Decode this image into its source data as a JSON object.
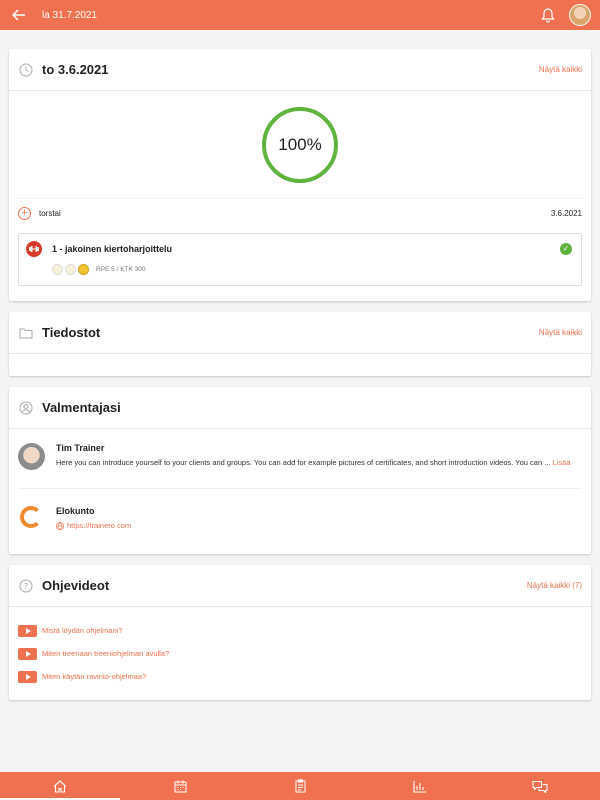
{
  "header": {
    "title": "la 31.7.2021"
  },
  "program": {
    "title": "to 3.6.2021",
    "show_all": "Näytä kaikki",
    "progress": "100%",
    "day_label": "torstai",
    "day_date": "3.6.2021",
    "workout": {
      "title": "1 - jakoinen kiertoharjoittelu",
      "meta": "RPE 5 / KTK 300",
      "completed": true
    }
  },
  "files": {
    "title": "Tiedostot",
    "show_all": "Näytä kaikki"
  },
  "coach": {
    "title": "Valmentajasi",
    "name": "Tim Trainer",
    "description": "Here you can introduce yourself to your clients and groups. You can add for example pictures of certificates, and short introduction videos. You can ...",
    "more": "Lisää",
    "org_name": "Elokunto",
    "org_url": "https://trainero.com"
  },
  "videos": {
    "title": "Ohjevideot",
    "show_all": "Näytä kaikki (7)",
    "items": [
      {
        "label": "Mistä löydän ohjelmani?"
      },
      {
        "label": "Miten treenaan treeniohjelman avulla?"
      },
      {
        "label": "Miten käytän ravinto-ohjelmaa?"
      }
    ]
  },
  "colors": {
    "accent": "#f0714f",
    "success": "#5db33b"
  }
}
